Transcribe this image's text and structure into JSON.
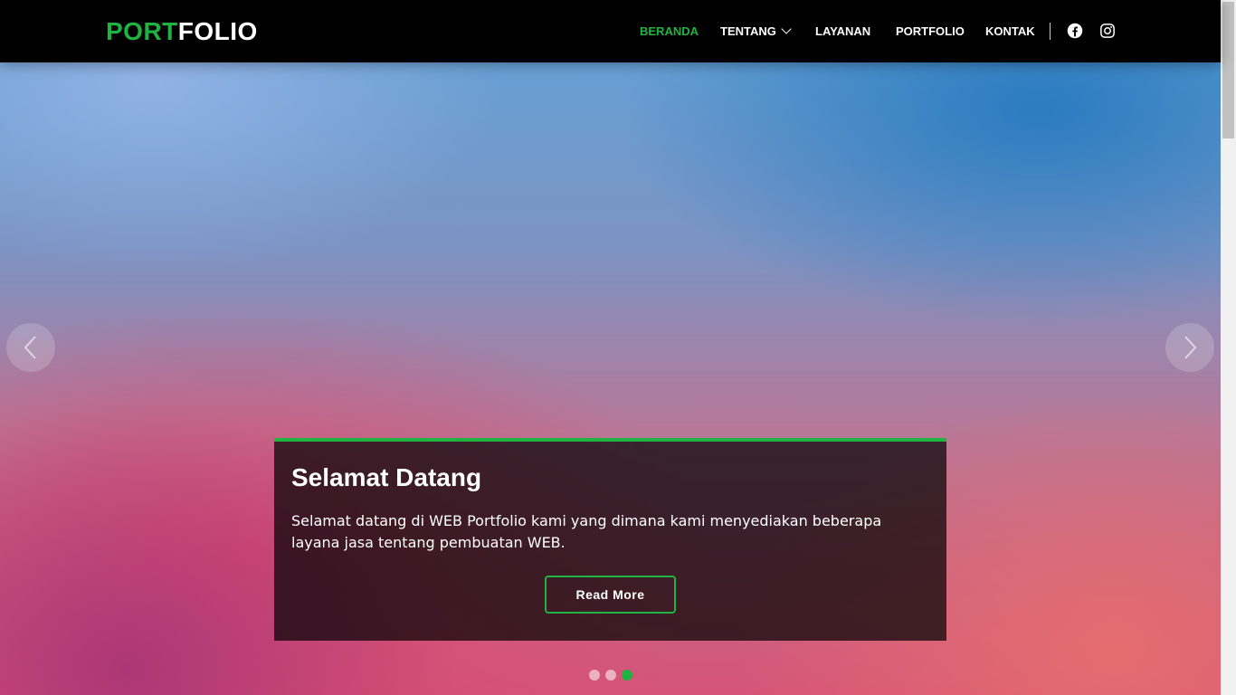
{
  "brand": {
    "part1": "PORT",
    "part2": "FOLIO",
    "accent": "#1fb341"
  },
  "nav": {
    "items": [
      {
        "label": "BERANDA",
        "active": true
      },
      {
        "label": "TENTANG",
        "dropdown": true
      },
      {
        "label": "LAYANAN"
      },
      {
        "label": "PORTFOLIO"
      },
      {
        "label": "KONTAK"
      }
    ],
    "social": [
      "facebook-icon",
      "instagram-icon"
    ]
  },
  "hero": {
    "title": "Selamat Datang",
    "text": "Selamat datang di WEB Portfolio kami yang dimana kami menyediakan beberapa layana jasa tentang pembuatan WEB.",
    "button": "Read More",
    "slides": 3,
    "active_slide": 3
  }
}
